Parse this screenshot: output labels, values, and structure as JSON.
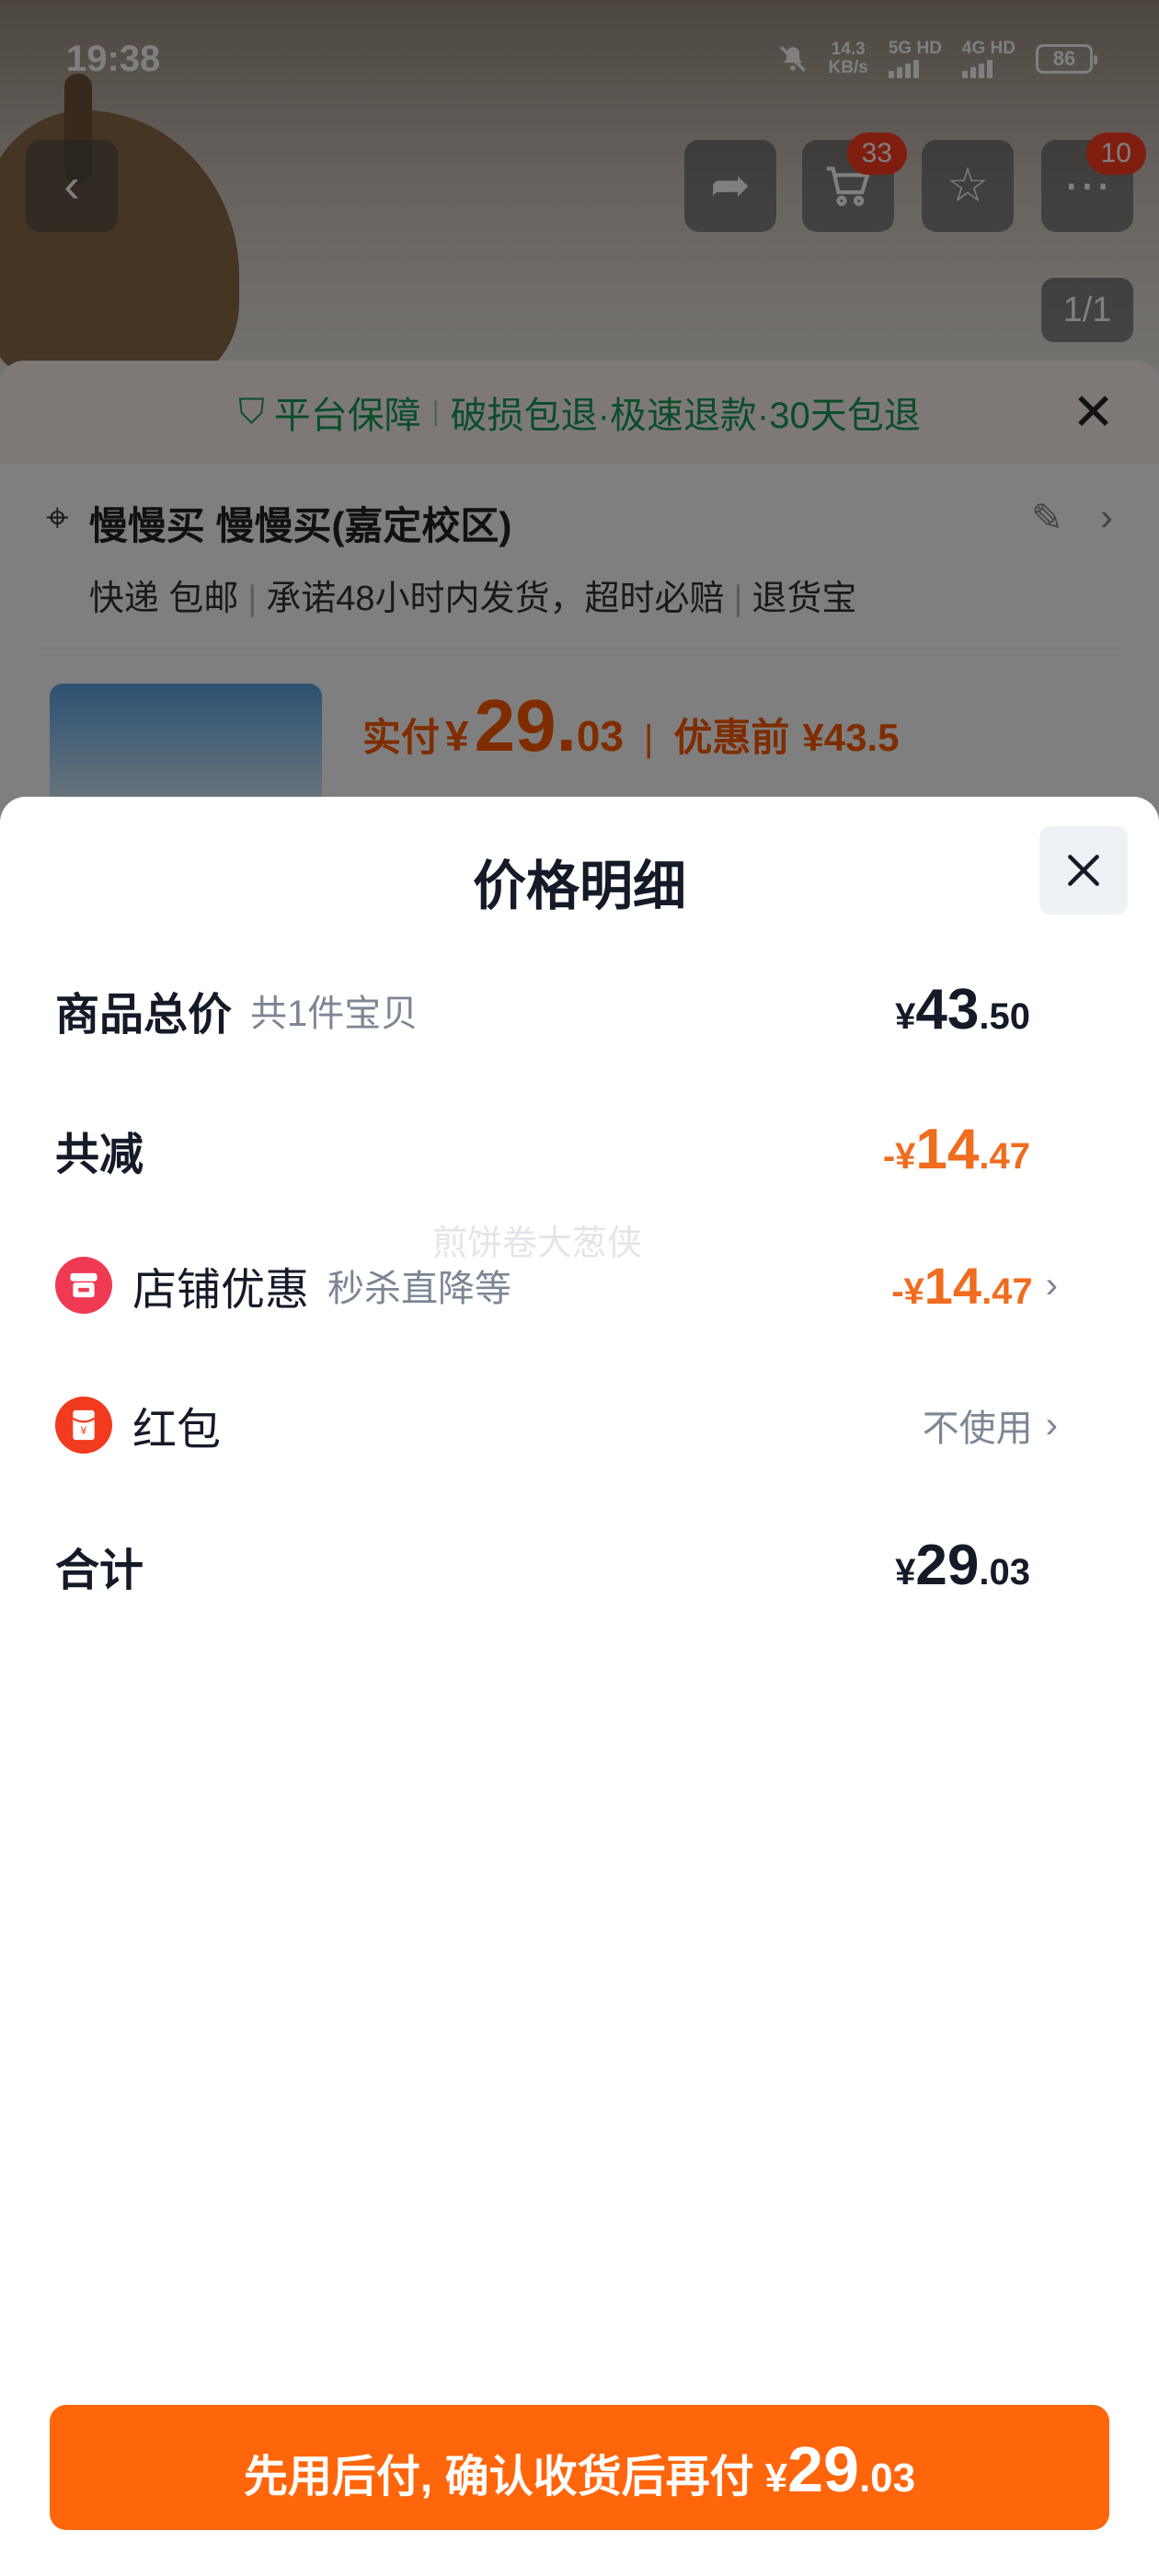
{
  "status_bar": {
    "time": "19:38",
    "net_speed_value": "14.3",
    "net_speed_unit": "KB/s",
    "sim1": "5G HD",
    "sim2": "4G HD",
    "battery": "86"
  },
  "background_page": {
    "cart_badge": "33",
    "more_badge": "10",
    "image_pager": "1/1",
    "guarantee": {
      "title": "平台保障",
      "text": "破损包退·极速退款·30天包退"
    },
    "address": {
      "name": "慢慢买 慢慢买(嘉定校区)",
      "shipping": "快递 包邮",
      "promise": "承诺48小时内发货，超时必赔",
      "return_service": "退货宝"
    },
    "price": {
      "paid_label": "实付",
      "currency": "¥",
      "paid_int": "29.",
      "paid_dec": "03",
      "before_label": "优惠前",
      "before_value": "¥43.5"
    }
  },
  "sheet": {
    "title": "价格明细",
    "watermark": "煎饼卷大葱侠",
    "rows": {
      "total": {
        "label": "商品总价",
        "sub": "共1件宝贝",
        "yen": "¥",
        "int": "43",
        "dec": ".50"
      },
      "reduce": {
        "label": "共减",
        "yen": "-¥",
        "int": "14",
        "dec": ".47"
      },
      "store": {
        "label": "店铺优惠",
        "sub": "秒杀直降等",
        "yen": "-¥",
        "int": "14",
        "dec": ".47"
      },
      "redpack": {
        "label": "红包",
        "value": "不使用"
      },
      "sum": {
        "label": "合计",
        "yen": "¥",
        "int": "29",
        "dec": ".03"
      }
    },
    "cta": {
      "text": "先用后付, 确认收货后再付",
      "yen": "¥",
      "int": "29",
      "dec": ".03"
    }
  },
  "colors": {
    "accent_orange": "#ff650b",
    "discount_orange": "#f06c1e",
    "guarantee_green": "#149a5a",
    "store_icon_red": "#f03a53"
  },
  "icons": [
    "back-icon",
    "share-icon",
    "cart-icon",
    "star-icon",
    "more-icon",
    "shield-check-icon",
    "close-icon",
    "location-pin-icon",
    "edit-icon",
    "chevron-right-icon",
    "store-icon",
    "red-packet-icon",
    "mute-bell-icon"
  ]
}
